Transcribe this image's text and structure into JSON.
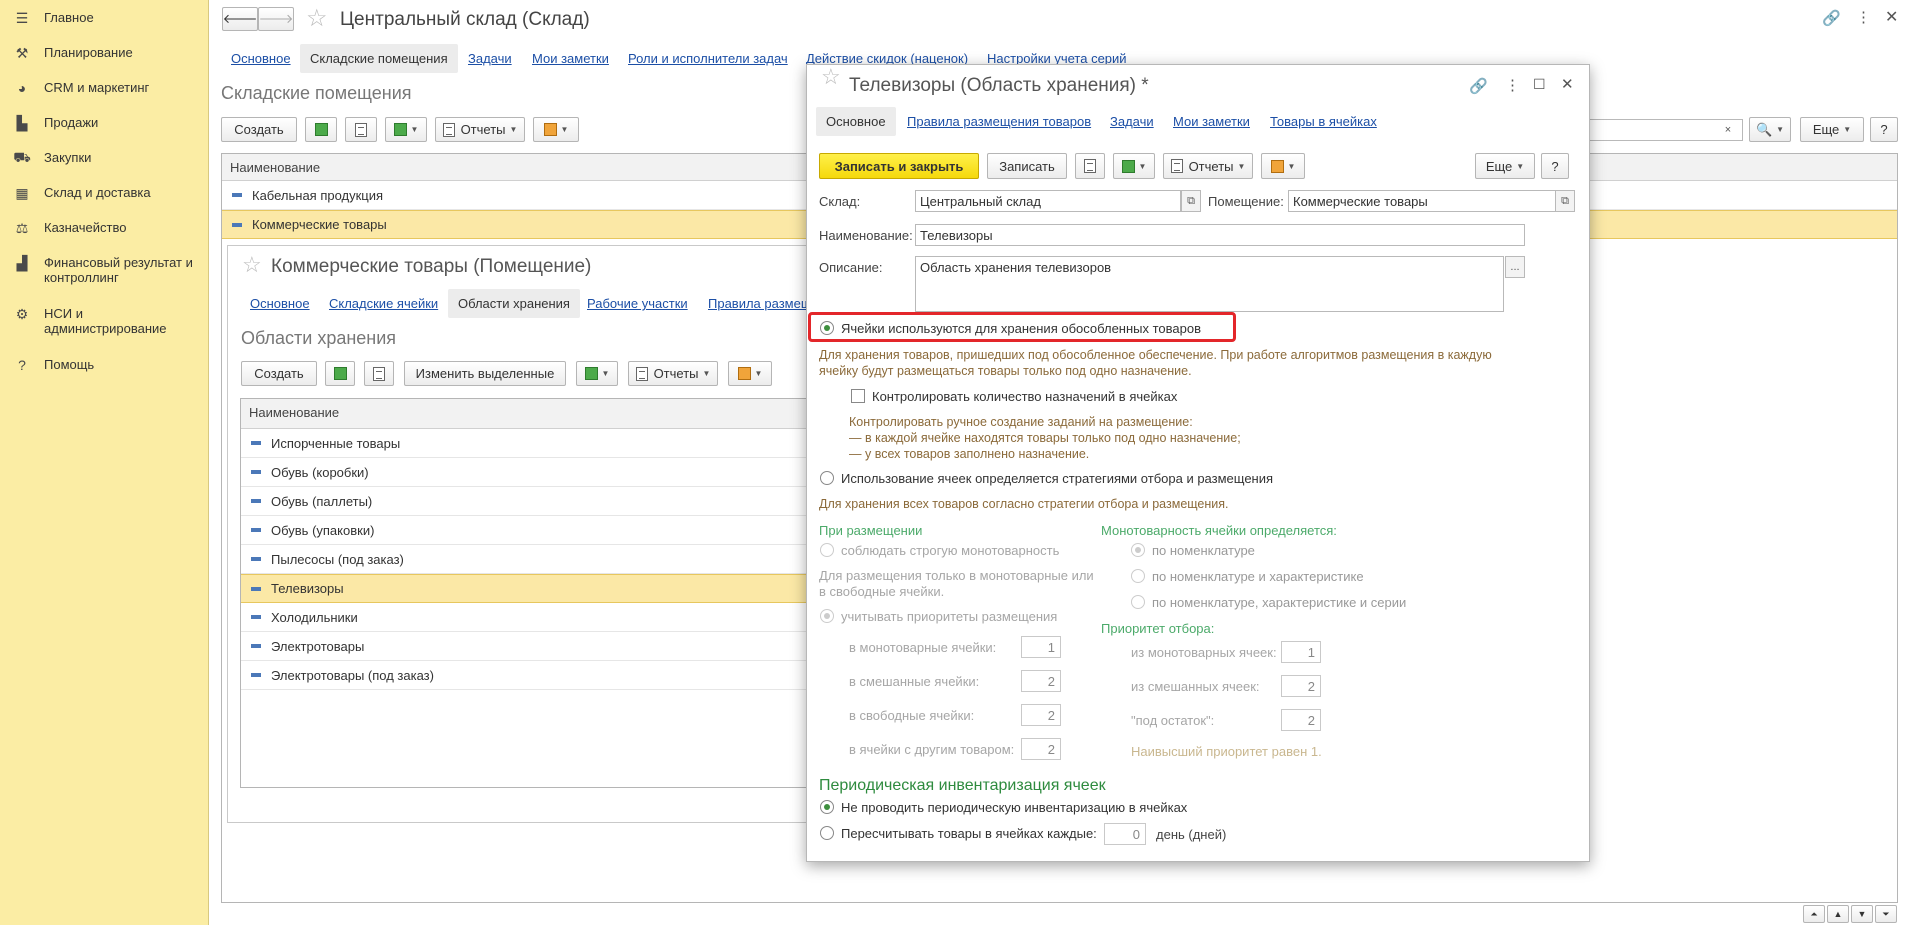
{
  "sidebar": {
    "items": [
      {
        "label": "Главное",
        "icon": "menu-icon"
      },
      {
        "label": "Планирование",
        "icon": "planning-icon"
      },
      {
        "label": "CRM и маркетинг",
        "icon": "crm-icon"
      },
      {
        "label": "Продажи",
        "icon": "bag-icon"
      },
      {
        "label": "Закупки",
        "icon": "cart-icon"
      },
      {
        "label": "Склад и доставка",
        "icon": "warehouse-icon"
      },
      {
        "label": "Казначейство",
        "icon": "treasury-icon"
      },
      {
        "label": "Финансовый результат и контроллинг",
        "icon": "chart-icon"
      },
      {
        "label": "НСИ и администрирование",
        "icon": "gear-icon"
      },
      {
        "label": "Помощь",
        "icon": "help-icon"
      }
    ]
  },
  "main": {
    "title": "Центральный склад (Склад)",
    "tabs": [
      "Основное",
      "Складские помещения",
      "Задачи",
      "Мои заметки",
      "Роли и исполнители задач",
      "Действие скидок (наценок)",
      "Настройки учета серий"
    ],
    "active_tab": "Складские помещения",
    "section_title": "Складские помещения",
    "toolbar": {
      "create": "Создать",
      "reports": "Отчеты",
      "more": "Еще",
      "help": "?"
    },
    "search_clear": "×",
    "table": {
      "header": "Наименование",
      "rows": [
        "Кабельная продукция",
        "Коммерческие товары"
      ]
    }
  },
  "sub": {
    "title": "Коммерческие товары (Помещение)",
    "tabs": [
      "Основное",
      "Складские ячейки",
      "Области хранения",
      "Рабочие участки",
      "Правила размещ"
    ],
    "active_tab": "Области хранения",
    "section_title": "Области хранения",
    "toolbar": {
      "create": "Создать",
      "change_selected": "Изменить выделенные",
      "reports": "Отчеты"
    },
    "table": {
      "header": "Наименование",
      "rows": [
        "Испорченные товары",
        "Обувь (коробки)",
        "Обувь (паллеты)",
        "Обувь (упаковки)",
        "Пылесосы (под заказ)",
        "Телевизоры",
        "Холодильники",
        "Электротовары",
        "Электротовары (под заказ)"
      ]
    }
  },
  "modal": {
    "title": "Телевизоры (Область хранения) *",
    "tabs": [
      "Основное",
      "Правила размещения товаров",
      "Задачи",
      "Мои заметки",
      "Товары в ячейках"
    ],
    "active_tab": "Основное",
    "toolbar": {
      "save_close": "Записать и закрыть",
      "save": "Записать",
      "reports": "Отчеты",
      "more": "Еще",
      "help": "?"
    },
    "fields": {
      "warehouse_label": "Склад:",
      "warehouse_value": "Центральный склад",
      "room_label": "Помещение:",
      "room_value": "Коммерческие товары",
      "name_label": "Наименование:",
      "name_value": "Телевизоры",
      "desc_label": "Описание:",
      "desc_value": "Область хранения телевизоров",
      "desc_btn": "..."
    },
    "option1": {
      "label": "Ячейки используются для хранения обособленных товаров",
      "hint_line1": "Для хранения товаров, пришедших под обособленное обеспечение. При работе алгоритмов размещения в каждую",
      "hint_line2": "ячейку будут размещаться товары только под одно назначение.",
      "check_label": "Контролировать количество назначений в ячейках",
      "check_hint1": "Контролировать ручное создание заданий на размещение:",
      "check_hint2": "— в каждой ячейке находятся товары только под одно назначение;",
      "check_hint3": "— у всех товаров заполнено назначение."
    },
    "option2": {
      "label": "Использование ячеек определяется стратегиями отбора и размещения",
      "hint": "Для хранения всех товаров согласно стратегии отбора и размещения."
    },
    "placement": {
      "header": "При размещении",
      "strict": "соблюдать строгую монотоварность",
      "hint1": "Для размещения только в монотоварные или",
      "hint2": "в свободные ячейки.",
      "priority": "учитывать приоритеты размещения",
      "rows": [
        {
          "label": "в монотоварные ячейки:",
          "value": "1"
        },
        {
          "label": "в смешанные ячейки:",
          "value": "2"
        },
        {
          "label": "в свободные ячейки:",
          "value": "2"
        },
        {
          "label": "в ячейки с другим товаром:",
          "value": "2"
        }
      ]
    },
    "mono": {
      "header": "Монотоварность ячейки определяется:",
      "options": [
        "по номенклатуре",
        "по номенклатуре и характеристике",
        "по номенклатуре, характеристике и серии"
      ]
    },
    "pick": {
      "header": "Приоритет отбора:",
      "rows": [
        {
          "label": "из монотоварных ячеек:",
          "value": "1"
        },
        {
          "label": "из смешанных ячеек:",
          "value": "2"
        },
        {
          "label": "\"под остаток\":",
          "value": "2"
        }
      ],
      "note": "Наивысший приоритет равен 1."
    },
    "inventory": {
      "header": "Периодическая инвентаризация ячеек",
      "opt1": "Не проводить периодическую инвентаризацию в ячейках",
      "opt2": "Пересчитывать товары в ячейках каждые:",
      "days_value": "0",
      "days_unit": "день (дней)"
    }
  }
}
